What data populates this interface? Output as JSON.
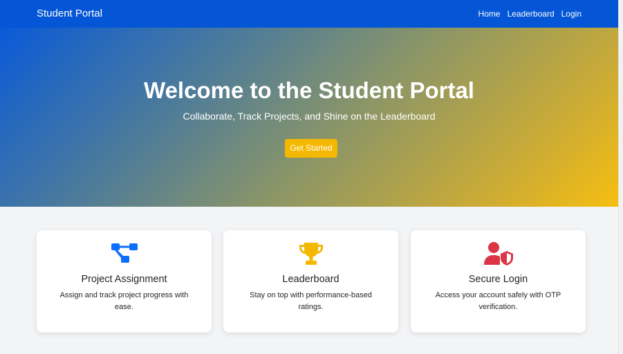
{
  "navbar": {
    "brand": "Student Portal",
    "links": [
      "Home",
      "Leaderboard",
      "Login"
    ]
  },
  "hero": {
    "title": "Welcome to the Student Portal",
    "subtitle": "Collaborate, Track Projects, and Shine on the Leaderboard",
    "cta_label": "Get Started"
  },
  "features": [
    {
      "icon": "project-diagram-icon",
      "title": "Project Assignment",
      "description": "Assign and track project progress with ease."
    },
    {
      "icon": "trophy-icon",
      "title": "Leaderboard",
      "description": "Stay on top with performance-based ratings."
    },
    {
      "icon": "user-shield-icon",
      "title": "Secure Login",
      "description": "Access your account safely with OTP verification."
    }
  ],
  "colors": {
    "primary": "#0456d6",
    "accent": "#f5b800",
    "icon_blue": "#0d6efd",
    "icon_yellow": "#f5b800",
    "icon_red": "#dc3545"
  }
}
